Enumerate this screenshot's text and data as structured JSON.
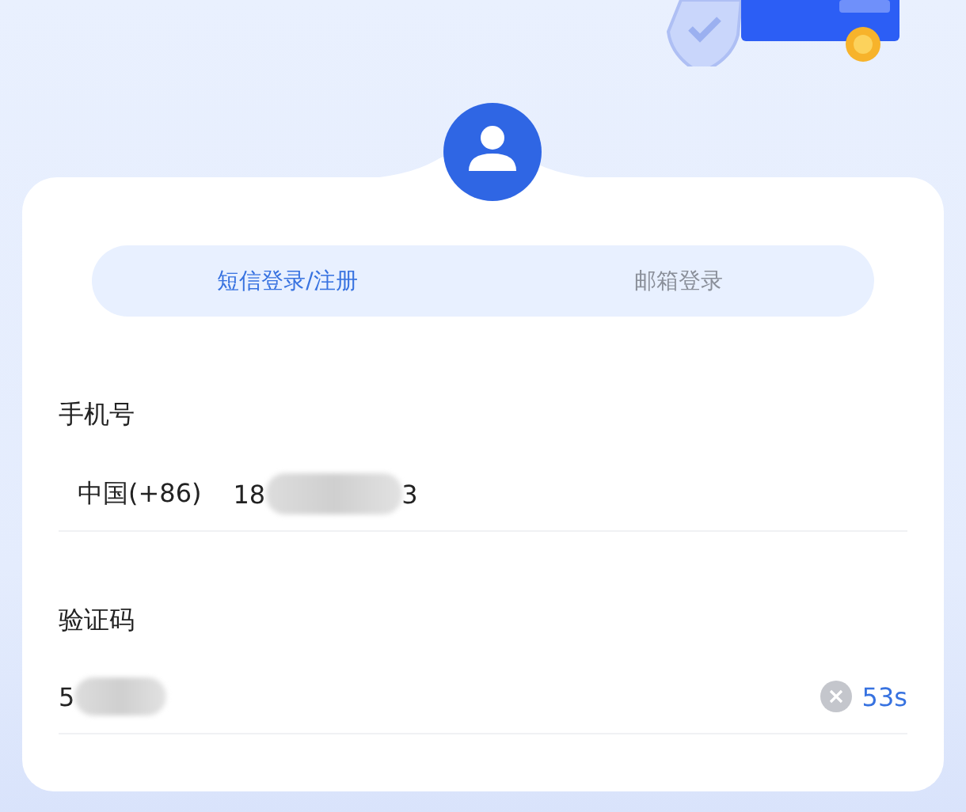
{
  "tabs": [
    {
      "label": "短信登录/注册",
      "selected": true
    },
    {
      "label": "邮箱登录",
      "selected": false
    }
  ],
  "phone": {
    "label": "手机号",
    "country_code": "中国(+86)",
    "value_start": "18",
    "value_end": "3",
    "redacted": true
  },
  "code": {
    "label": "验证码",
    "value_start": "5",
    "redacted": true,
    "countdown": "53s"
  }
}
